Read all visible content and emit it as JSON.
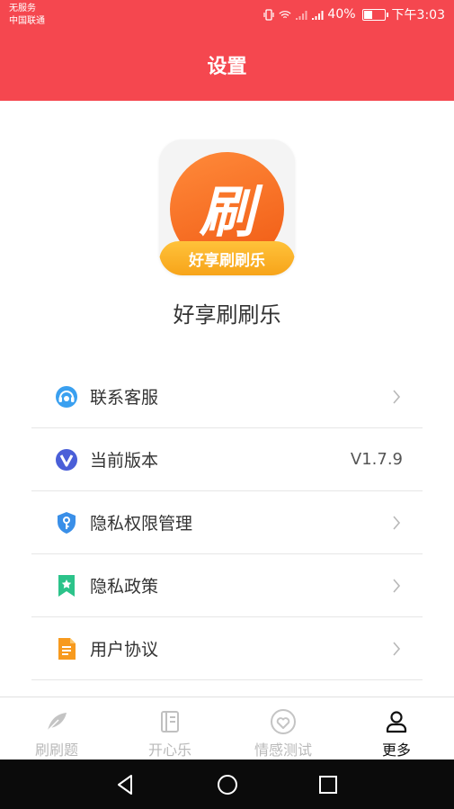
{
  "status_bar": {
    "carrier_line1": "无服务",
    "carrier_line2": "中国联通",
    "battery_percent": "40%",
    "battery_level": 0.4,
    "time": "下午3:03"
  },
  "header": {
    "title": "设置"
  },
  "app": {
    "logo_char": "刷",
    "logo_band_text": "好享刷刷乐",
    "name": "好享刷刷乐"
  },
  "menu": {
    "items": [
      {
        "label": "联系客服",
        "icon": "headset-icon",
        "value": ""
      },
      {
        "label": "当前版本",
        "icon": "version-icon",
        "value": "V1.7.9"
      },
      {
        "label": "隐私权限管理",
        "icon": "shield-key-icon",
        "value": ""
      },
      {
        "label": "隐私政策",
        "icon": "bookmark-star-icon",
        "value": ""
      },
      {
        "label": "用户协议",
        "icon": "document-icon",
        "value": ""
      }
    ]
  },
  "tabbar": {
    "tabs": [
      {
        "label": "刷刷题",
        "icon": "feather-icon",
        "active": false
      },
      {
        "label": "开心乐",
        "icon": "notebook-icon",
        "active": false
      },
      {
        "label": "情感测试",
        "icon": "heart-icon",
        "active": false
      },
      {
        "label": "更多",
        "icon": "person-icon",
        "active": true
      }
    ]
  },
  "colors": {
    "header_bg": "#f5474f",
    "accent_orange": "#f05a14",
    "inactive_tab": "#b9b9b9",
    "active_tab": "#111111"
  }
}
